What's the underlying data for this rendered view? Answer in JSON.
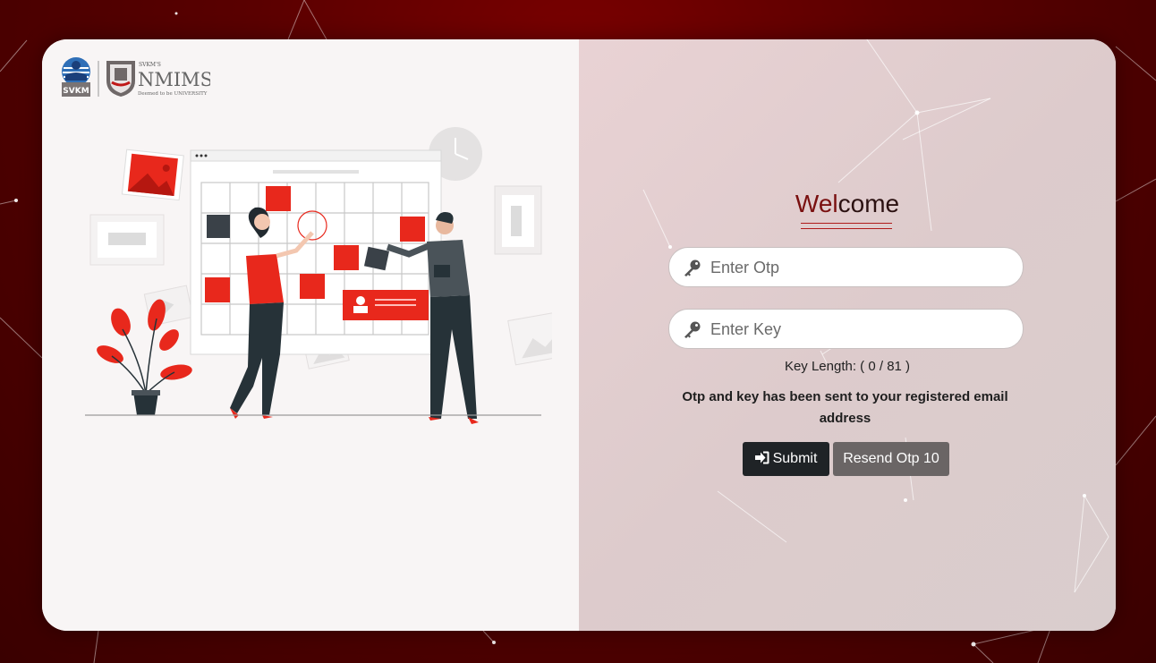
{
  "brand": {
    "svkm_label": "SVKM",
    "svkms_label": "SVKM'S",
    "nmims_label": "NMIMS",
    "deemed_label": "Deemed to be UNIVERSITY"
  },
  "form": {
    "title_part1": "Wel",
    "title_part2": "come",
    "otp_placeholder": "Enter Otp",
    "key_placeholder": "Enter Key",
    "key_length_text": "Key Length: ( 0 / 81 )",
    "info_message": "Otp and key has been sent to your registered email address",
    "submit_label": "Submit",
    "resend_label": "Resend Otp 10"
  },
  "icons": {
    "field_icon": "key-icon",
    "submit_icon": "sign-in-icon"
  },
  "colors": {
    "accent_red": "#e8281c",
    "dark_button": "#1f2326",
    "resend_button": "#6a6565",
    "background": "#5a0000"
  }
}
